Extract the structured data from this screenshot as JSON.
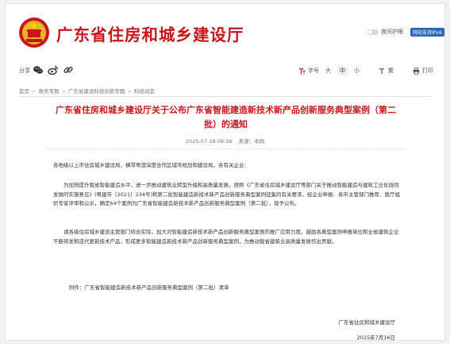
{
  "header": {
    "site_title": "广东省住房和城乡建设厅",
    "eye_mode_label": "夜间护眼",
    "ipv6_badge": "网站支持IPv6"
  },
  "toolbar": {
    "share_label": "分享",
    "share_icons": [
      "wechat-icon",
      "weibo-icon",
      "link-icon"
    ],
    "font_size_label": "字号",
    "size_large": "大",
    "size_medium": "中",
    "size_small": "小",
    "traditional_label": "繁",
    "print_label": "打印"
  },
  "breadcrumb": [
    "首页",
    "政务专题",
    "广东省建设科技创新专题",
    "科技动态"
  ],
  "article": {
    "title": "广东省住房和城乡建设厅关于公布广东省智能建造新技术新产品创新服务典型案例（第二批）的通知",
    "date": "2025-07-18  08:56",
    "source": "来源：本网",
    "salutation": "各地级以上市住房城乡建设局，横琴粤澳深度合作区城市规划和建设局，各有关企业：",
    "paragraph1": "为加快提升我省智能建造水平，进一步推动建筑业转型升级和高质量发展，按照《广东省住房城乡建设厅等部门关于推动智能建造与建筑工业化协同发展的实施意见》(粤建市〔2021〕234号)和第二批智能建造新技术新产品创新服务典型案例征集的有关要求，经企业申报、各市主管部门推荐、我厅组织专家评审和公示，确定64个案例为广东省智能建造新技术新产品创新服务典型案例（第二批），现予公布。",
    "paragraph2": "请各级住房城乡建设主管部门结合实际，加大对智能建造新技术新产品创新服务典型案例的推广应用力度。鼓励各典型案例申报单位和全省建筑企业不断研发和迭代更新技术产品，形成更多智能建造新技术新产品创新服务典型案例，为推动我省建筑业高质量发展作出贡献。",
    "attachment": "附件：广东省智能建造新技术新产品创新服务典型案例（第二批）清单",
    "signature_org": "广东省住房和城乡建设厅",
    "signature_date": "2025年7月16日"
  },
  "colors": {
    "accent_red": "#c8161d",
    "badge_blue": "#2a6ab8"
  }
}
